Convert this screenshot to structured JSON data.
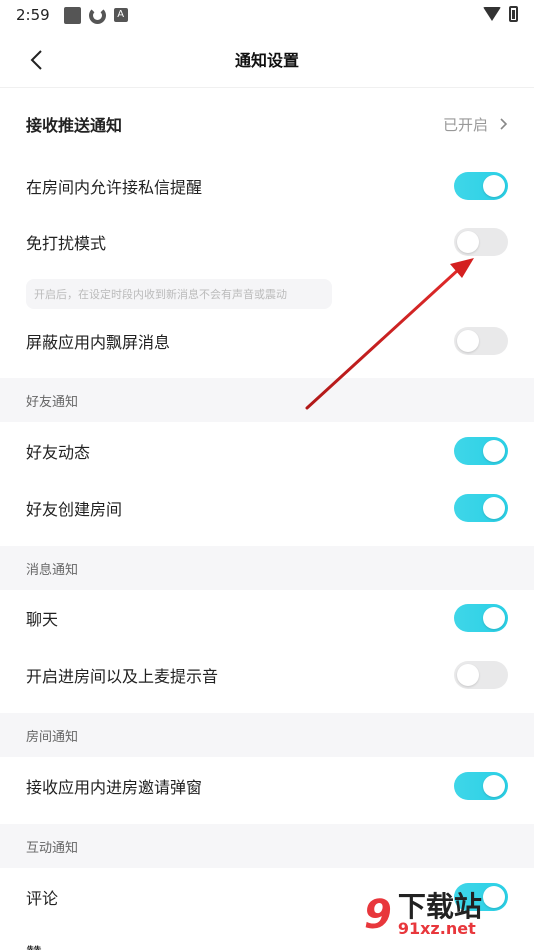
{
  "status_bar": {
    "time": "2:59",
    "icons": [
      "app-square-icon",
      "sync-icon",
      "a-icon"
    ],
    "right_icons": [
      "wifi-icon",
      "battery-icon"
    ]
  },
  "nav": {
    "title": "通知设置",
    "back_icon": "chevron-left-icon"
  },
  "receive_push": {
    "label": "接收推送通知",
    "value": "已开启"
  },
  "settings": {
    "private_msg": {
      "label": "在房间内允许接私信提醒",
      "enabled": true
    },
    "dnd": {
      "label": "免打扰模式",
      "enabled": false
    },
    "dnd_hint": "开启后，在设定时段内收到新消息不会有声音或震动",
    "block_float": {
      "label": "屏蔽应用内飘屏消息",
      "enabled": false
    }
  },
  "sections": {
    "friend": "好友通知",
    "message": "消息通知",
    "room": "房间通知",
    "interaction": "互动通知"
  },
  "friend_items": {
    "dynamic": {
      "label": "好友动态",
      "enabled": true
    },
    "create_room": {
      "label": "好友创建房间",
      "enabled": true
    }
  },
  "message_items": {
    "chat": {
      "label": "聊天",
      "enabled": true
    },
    "enter_room_sound": {
      "label": "开启进房间以及上麦提示音",
      "enabled": false
    }
  },
  "room_items": {
    "invite_popup": {
      "label": "接收应用内进房邀请弹窗",
      "enabled": true
    }
  },
  "interaction_items": {
    "comment": {
      "label": "评论",
      "enabled": true
    },
    "like": {
      "label": "赞"
    }
  },
  "watermark": {
    "logo": "9",
    "cn": "下载站",
    "url": "91xz.net"
  },
  "colors": {
    "toggle_on": "#2ad0e6",
    "toggle_off": "#e9e9ea",
    "section_bg": "#f6f6f8",
    "annotation_arrow": "#d42020"
  }
}
